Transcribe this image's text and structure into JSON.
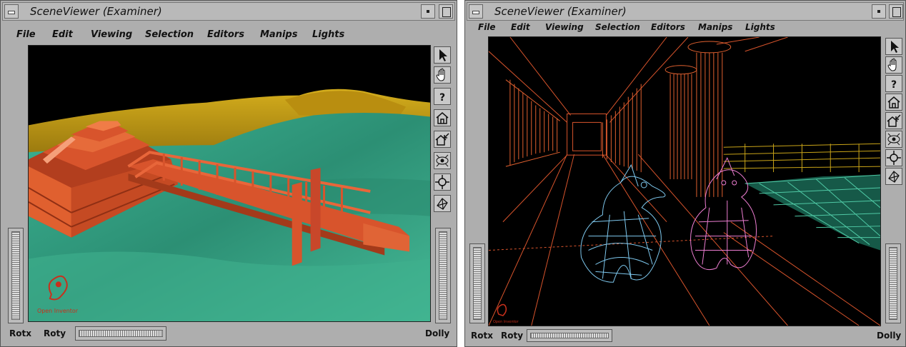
{
  "windows": [
    {
      "id": "left",
      "title": "SceneViewer (Examiner)",
      "menu": [
        "File",
        "Edit",
        "Viewing",
        "Selection",
        "Editors",
        "Manips",
        "Lights"
      ],
      "tools": [
        "arrow-icon",
        "hand-icon",
        "help-icon",
        "home-icon",
        "set-home-icon",
        "view-all-icon",
        "seek-icon",
        "perspective-icon"
      ],
      "logo_text": "Open Inventor",
      "labels": {
        "rotx": "Rotx",
        "roty": "Roty",
        "dolly": "Dolly"
      }
    },
    {
      "id": "right",
      "title": "SceneViewer (Examiner)",
      "menu": [
        "File",
        "Edit",
        "Viewing",
        "Selection",
        "Editors",
        "Manips",
        "Lights"
      ],
      "tools": [
        "arrow-icon",
        "hand-icon",
        "help-icon",
        "home-icon",
        "set-home-icon",
        "view-all-icon",
        "seek-icon",
        "perspective-icon"
      ],
      "logo_text": "Open Inventor",
      "labels": {
        "rotx": "Rotx",
        "roty": "Roty",
        "dolly": "Dolly"
      }
    }
  ],
  "colors": {
    "chrome": "#aeaeae",
    "water": "#3aa98b",
    "sand": "#c9a418",
    "structure": "#d8542c",
    "bird_blue": "#7ec8ee",
    "bird_pink": "#ee7ed2",
    "wire_green": "#4fc9a5"
  }
}
